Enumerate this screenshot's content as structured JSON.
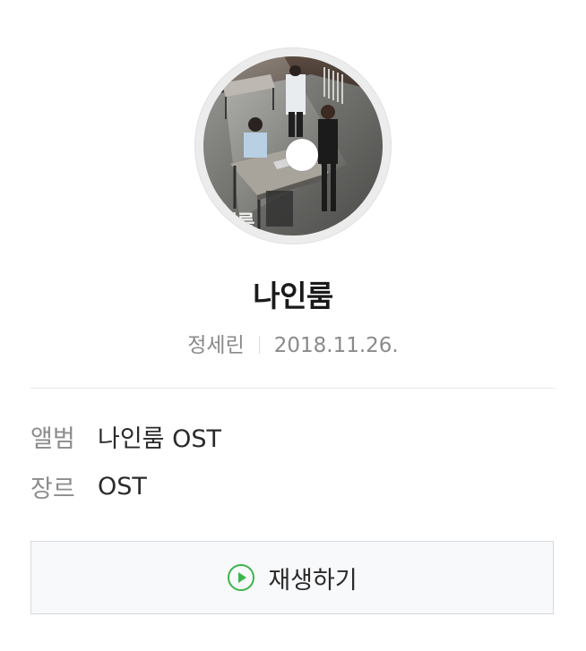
{
  "album_cover": {
    "watermark": "인룸"
  },
  "song": {
    "title": "나인룸",
    "artist": "정세린",
    "release_date": "2018.11.26."
  },
  "info": {
    "album_label": "앨범",
    "album_value": "나인룸 OST",
    "genre_label": "장르",
    "genre_value": "OST"
  },
  "play_button": {
    "label": "재생하기",
    "icon": "play-circle-icon",
    "icon_color": "#3cb54a"
  }
}
